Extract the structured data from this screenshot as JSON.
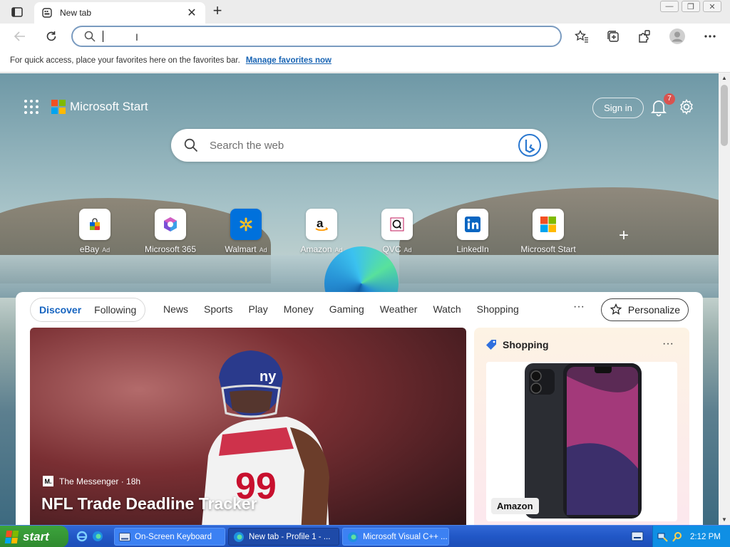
{
  "tab": {
    "title": "New tab"
  },
  "omnibox": {
    "value": ""
  },
  "favorites_bar": {
    "message": "For quick access, place your favorites here on the favorites bar.",
    "link": "Manage favorites now"
  },
  "start": {
    "brand": "Microsoft Start",
    "sign_in": "Sign in",
    "notification_count": "7",
    "search_placeholder": "Search the web"
  },
  "quick_links": [
    {
      "label": "eBay",
      "ad": "Ad",
      "icon": "ebay-bag-icon"
    },
    {
      "label": "Microsoft 365",
      "ad": "",
      "icon": "microsoft-365-icon"
    },
    {
      "label": "Walmart",
      "ad": "Ad",
      "icon": "walmart-spark-icon"
    },
    {
      "label": "Amazon",
      "ad": "Ad",
      "icon": "amazon-icon"
    },
    {
      "label": "QVC",
      "ad": "Ad",
      "icon": "qvc-icon"
    },
    {
      "label": "LinkedIn",
      "ad": "",
      "icon": "linkedin-icon"
    },
    {
      "label": "Microsoft Start",
      "ad": "",
      "icon": "microsoft-logo-icon"
    }
  ],
  "feed": {
    "primary_tabs": [
      "Discover",
      "Following"
    ],
    "categories": [
      "News",
      "Sports",
      "Play",
      "Money",
      "Gaming",
      "Weather",
      "Watch",
      "Shopping"
    ],
    "more": "···",
    "personalize": "Personalize",
    "hero": {
      "source_logo": "M.",
      "source": "The Messenger · 18h",
      "headline": "NFL Trade Deadline Tracker"
    },
    "shopping_card": {
      "title": "Shopping",
      "more": "···",
      "vendor": "Amazon"
    }
  },
  "taskbar": {
    "start": "start",
    "tasks": [
      {
        "label": "On-Screen Keyboard",
        "state": "normal"
      },
      {
        "label": "New tab - Profile 1 - ...",
        "state": "active"
      },
      {
        "label": "Microsoft Visual C++ ...",
        "state": "normal"
      }
    ],
    "clock": "2:12 PM"
  },
  "colors": {
    "accent": "#1664c0",
    "link": "#1763b3",
    "taskbar": "#2157c7",
    "start_green": "#3ca33c",
    "tray": "#0f8fe4"
  }
}
